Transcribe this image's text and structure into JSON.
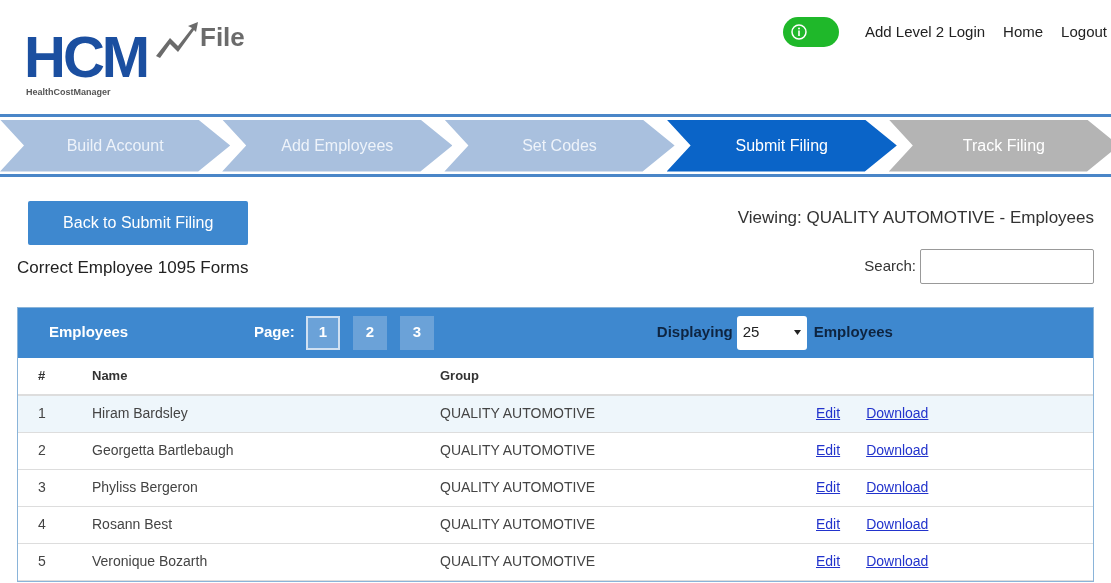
{
  "logo": {
    "mark": "HCM",
    "word": "File",
    "tagline": "HealthCostManager"
  },
  "header": {
    "toggle": {
      "on": true
    },
    "links": [
      "Add Level 2 Login",
      "Home",
      "Logout"
    ]
  },
  "steps": [
    {
      "label": "Build Account",
      "kind": "done"
    },
    {
      "label": "Add Employees",
      "kind": "done"
    },
    {
      "label": "Set Codes",
      "kind": "done"
    },
    {
      "label": "Submit Filing",
      "kind": "current"
    },
    {
      "label": "Track Filing",
      "kind": "upcoming"
    }
  ],
  "back_button": "Back to Submit Filing",
  "viewing": "Viewing: QUALITY AUTOMOTIVE - Employees",
  "subtitle": "Correct Employee 1095 Forms",
  "search": {
    "label": "Search:"
  },
  "table": {
    "title": "Employees",
    "page_label": "Page:",
    "pages": [
      {
        "label": "1",
        "selected": true
      },
      {
        "label": "2",
        "selected": false
      },
      {
        "label": "3",
        "selected": false
      }
    ],
    "displaying_label": "Displaying",
    "page_size": "25",
    "displaying_suffix": "Employees",
    "columns": [
      "#",
      "Name",
      "Group"
    ],
    "rows": [
      {
        "num": "1",
        "name": "Hiram Bardsley",
        "group": "QUALITY AUTOMOTIVE",
        "edit": "Edit",
        "download": "Download",
        "selected": true
      },
      {
        "num": "2",
        "name": "Georgetta Bartlebaugh",
        "group": "QUALITY AUTOMOTIVE",
        "edit": "Edit",
        "download": "Download",
        "selected": false
      },
      {
        "num": "3",
        "name": "Phyliss Bergeron",
        "group": "QUALITY AUTOMOTIVE",
        "edit": "Edit",
        "download": "Download",
        "selected": false
      },
      {
        "num": "4",
        "name": "Rosann Best",
        "group": "QUALITY AUTOMOTIVE",
        "edit": "Edit",
        "download": "Download",
        "selected": false
      },
      {
        "num": "5",
        "name": "Veronique Bozarth",
        "group": "QUALITY AUTOMOTIVE",
        "edit": "Edit",
        "download": "Download",
        "selected": false
      }
    ]
  }
}
